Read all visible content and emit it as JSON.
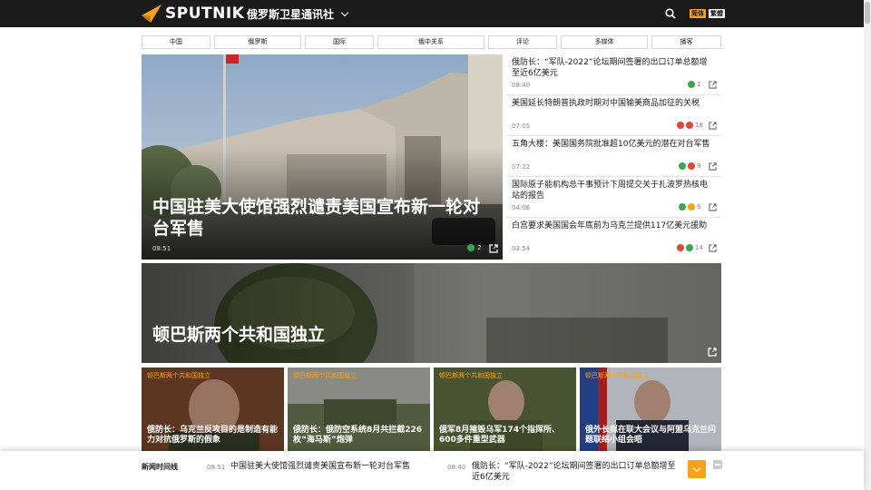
{
  "header": {
    "logo_text": "SPUTNIK",
    "site_name": "俄罗斯卫星通讯社",
    "lang_a": "简体",
    "lang_b": "繁體",
    "accent": "#f8a21b"
  },
  "nav": [
    {
      "label": "中国"
    },
    {
      "label": "俄罗斯"
    },
    {
      "label": "国际"
    },
    {
      "label": "俄中关系"
    },
    {
      "label": "评论"
    },
    {
      "label": "多媒体"
    },
    {
      "label": "播客"
    }
  ],
  "hero": {
    "title": "中国驻美大使馆强烈谴责美国宣布新一轮对台军售",
    "time": "08:51",
    "reactions": "2"
  },
  "side_news": [
    {
      "title": "俄防长：“军队-2022”论坛期间签署的出口订单总额增至近6亿美元",
      "time": "08:40",
      "reactions": "1",
      "colors": [
        "#3aa853"
      ]
    },
    {
      "title": "美国延长特朗普执政时期对中国输美商品加征的关税",
      "time": "07:05",
      "reactions": "18",
      "colors": [
        "#e0463a",
        "#e0463a"
      ]
    },
    {
      "title": "五角大楼：美国国务院批准超10亿美元的潜在对台军售",
      "time": "07:22",
      "reactions": "9",
      "colors": [
        "#3aa853",
        "#e0463a"
      ]
    },
    {
      "title": "国际原子能机构总干事预计下周提交关于扎波罗热核电站的报告",
      "time": "04:06",
      "reactions": "6",
      "colors": [
        "#3aa853",
        "#f8a21b"
      ]
    },
    {
      "title": "白宫要求美国国会年底前为乌克兰提供117亿美元援助",
      "time": "03:54",
      "reactions": "14",
      "colors": [
        "#e0463a",
        "#3aa853"
      ]
    }
  ],
  "banner": {
    "title": "顿巴斯两个共和国独立"
  },
  "cards": [
    {
      "tag": "顿巴斯两个共和国独立",
      "title": "俄防长：乌克兰反攻目的是制造有能力对抗俄罗斯的假象"
    },
    {
      "tag": "顿巴斯两个共和国独立",
      "title": "俄防长：俄防空系统8月共拦截226枚“海马斯”炮弹"
    },
    {
      "tag": "顿巴斯两个共和国独立",
      "title": "俄军8月摧毁乌军174个指挥所、600多件重型武器"
    },
    {
      "tag": "顿巴斯两个共和国独立",
      "title": "俄外长拟在联大会议与阿盟乌克兰问题联络小组会晤"
    }
  ],
  "ticker": {
    "label": "新闻时间线",
    "items": [
      {
        "time": "08:51",
        "title": "中国驻美大使馆强烈谴责美国宣布新一轮对台军售"
      },
      {
        "time": "08:40",
        "title": "俄防长：“军队-2022”论坛期间签署的出口订单总额增至近6亿美元"
      }
    ]
  }
}
